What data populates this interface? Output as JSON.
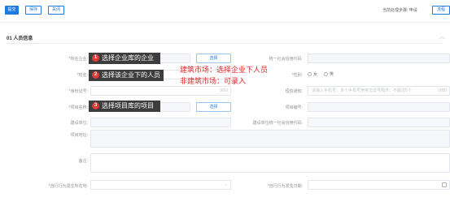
{
  "toolbar": {
    "submit_label": "提交",
    "save_label": "保存",
    "close_label": "关闭",
    "step_text": "当前处理步骤: 申请",
    "flow_label": "流程"
  },
  "section": {
    "title": "01  人员信息",
    "collapse_icon": "chevron-up-icon"
  },
  "form": {
    "company_label": "所在企业:",
    "company_tip_number": "1",
    "company_tip": "选择企业库的企业",
    "select_button_label": "选择",
    "credit_code_label": "统一社会信用代码:",
    "name_label": "姓名:",
    "name_tip_number": "2",
    "name_tip": "选择该企业下的人员",
    "gender_label": "性别:",
    "gender_options": [
      "女",
      "男"
    ],
    "id_card_label": "身份证号:",
    "id_card_count": "0/50",
    "phone_label": "短信通知:",
    "phone_placeholder": "请输入手机号，多个手机号用英文逗号隔开，不超过5个",
    "phone_count": "0/50",
    "project_name_label": "项目名称:",
    "project_tip_number": "3",
    "project_tip": "选择项目库的项目",
    "project_select_label": "选择",
    "project_code_label": "项目编号:",
    "build_unit_label": "建设单位:",
    "build_unit_code_label": "建设单位统一社会信用代码:",
    "project_address_label": "项目地址:",
    "remark_label": "备注:",
    "bad_behavior_location_label": "自行行为发生所在地:",
    "bad_behavior_date_label": "自行行为发生日期:"
  },
  "notes": {
    "line1": "建筑市场：选择企业下人员",
    "line2": "非建筑市场：可录入"
  },
  "colors": {
    "primary": "#1f7ae0",
    "required": "#f56c6c",
    "note_red": "#e0292b",
    "tip_bg": "#3d3d3d"
  }
}
